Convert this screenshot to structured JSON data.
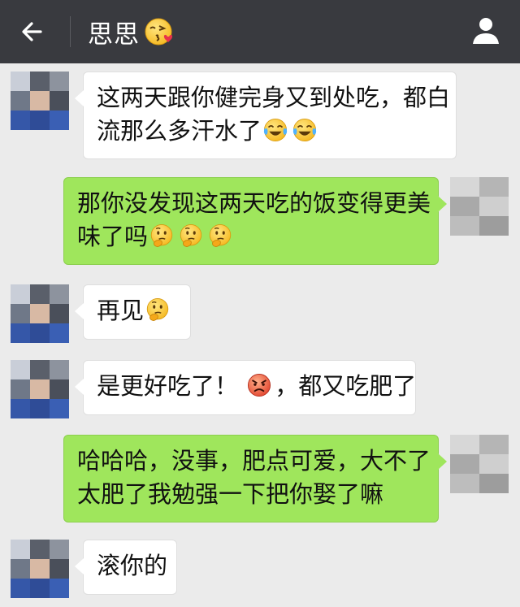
{
  "header": {
    "back_icon": "arrow-left-icon",
    "title": "思思",
    "title_emoji": "kissing-face-heart-emoji",
    "profile_icon": "person-icon",
    "background": "#393a3f"
  },
  "colors": {
    "chat_background": "#ebebeb",
    "incoming_bubble": "#ffffff",
    "outgoing_bubble": "#9fe65c"
  },
  "messages": [
    {
      "side": "left",
      "lines": [
        "这两天跟你健完身又到处吃，都白",
        "流那么多汗水了"
      ],
      "emojis": [
        "tears-of-joy-emoji",
        "tears-of-joy-emoji"
      ]
    },
    {
      "side": "right",
      "lines": [
        "那你没发现这两天吃的饭变得更美",
        "味了吗"
      ],
      "emojis": [
        "thinking-face-emoji",
        "thinking-face-emoji",
        "thinking-face-emoji"
      ]
    },
    {
      "side": "left",
      "lines": [
        "再见"
      ],
      "emojis": [
        "thinking-face-emoji"
      ]
    },
    {
      "side": "left",
      "lines": [
        "是更好吃了！",
        "，都又吃肥了"
      ],
      "emojis": [
        "angry-face-emoji"
      ]
    },
    {
      "side": "right",
      "lines": [
        "哈哈哈，没事，肥点可爱，大不了",
        "太肥了我勉强一下把你娶了嘛"
      ],
      "emojis": []
    },
    {
      "side": "left",
      "lines": [
        "滚你的"
      ],
      "emojis": []
    }
  ]
}
